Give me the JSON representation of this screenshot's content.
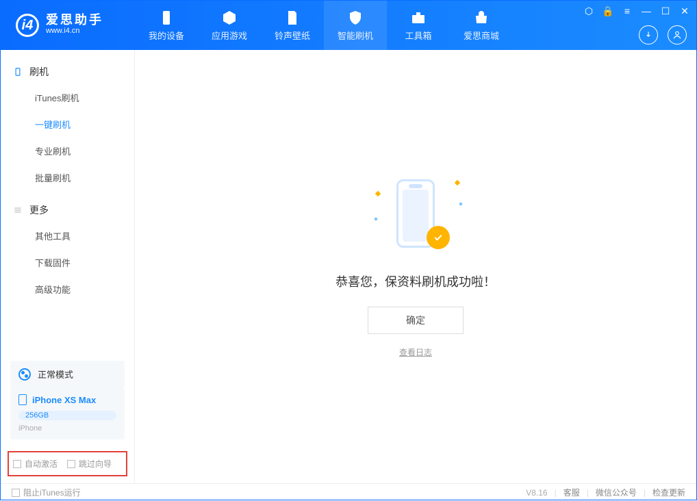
{
  "app": {
    "title": "爱思助手",
    "subtitle": "www.i4.cn"
  },
  "header_tabs": [
    {
      "label": "我的设备"
    },
    {
      "label": "应用游戏"
    },
    {
      "label": "铃声壁纸"
    },
    {
      "label": "智能刷机"
    },
    {
      "label": "工具箱"
    },
    {
      "label": "爱思商城"
    }
  ],
  "sidebar": {
    "flash_head": "刷机",
    "flash_items": [
      {
        "label": "iTunes刷机"
      },
      {
        "label": "一键刷机"
      },
      {
        "label": "专业刷机"
      },
      {
        "label": "批量刷机"
      }
    ],
    "more_head": "更多",
    "more_items": [
      {
        "label": "其他工具"
      },
      {
        "label": "下载固件"
      },
      {
        "label": "高级功能"
      }
    ]
  },
  "mode": {
    "label": "正常模式"
  },
  "device": {
    "name": "iPhone XS Max",
    "storage": "256GB",
    "type": "iPhone"
  },
  "options": {
    "auto_activate": "自动激活",
    "skip_guide": "跳过向导"
  },
  "main": {
    "message": "恭喜您，保资料刷机成功啦！",
    "ok": "确定",
    "view_log": "查看日志"
  },
  "footer": {
    "block_itunes": "阻止iTunes运行",
    "version": "V8.16",
    "support": "客服",
    "wechat": "微信公众号",
    "update": "检查更新"
  }
}
